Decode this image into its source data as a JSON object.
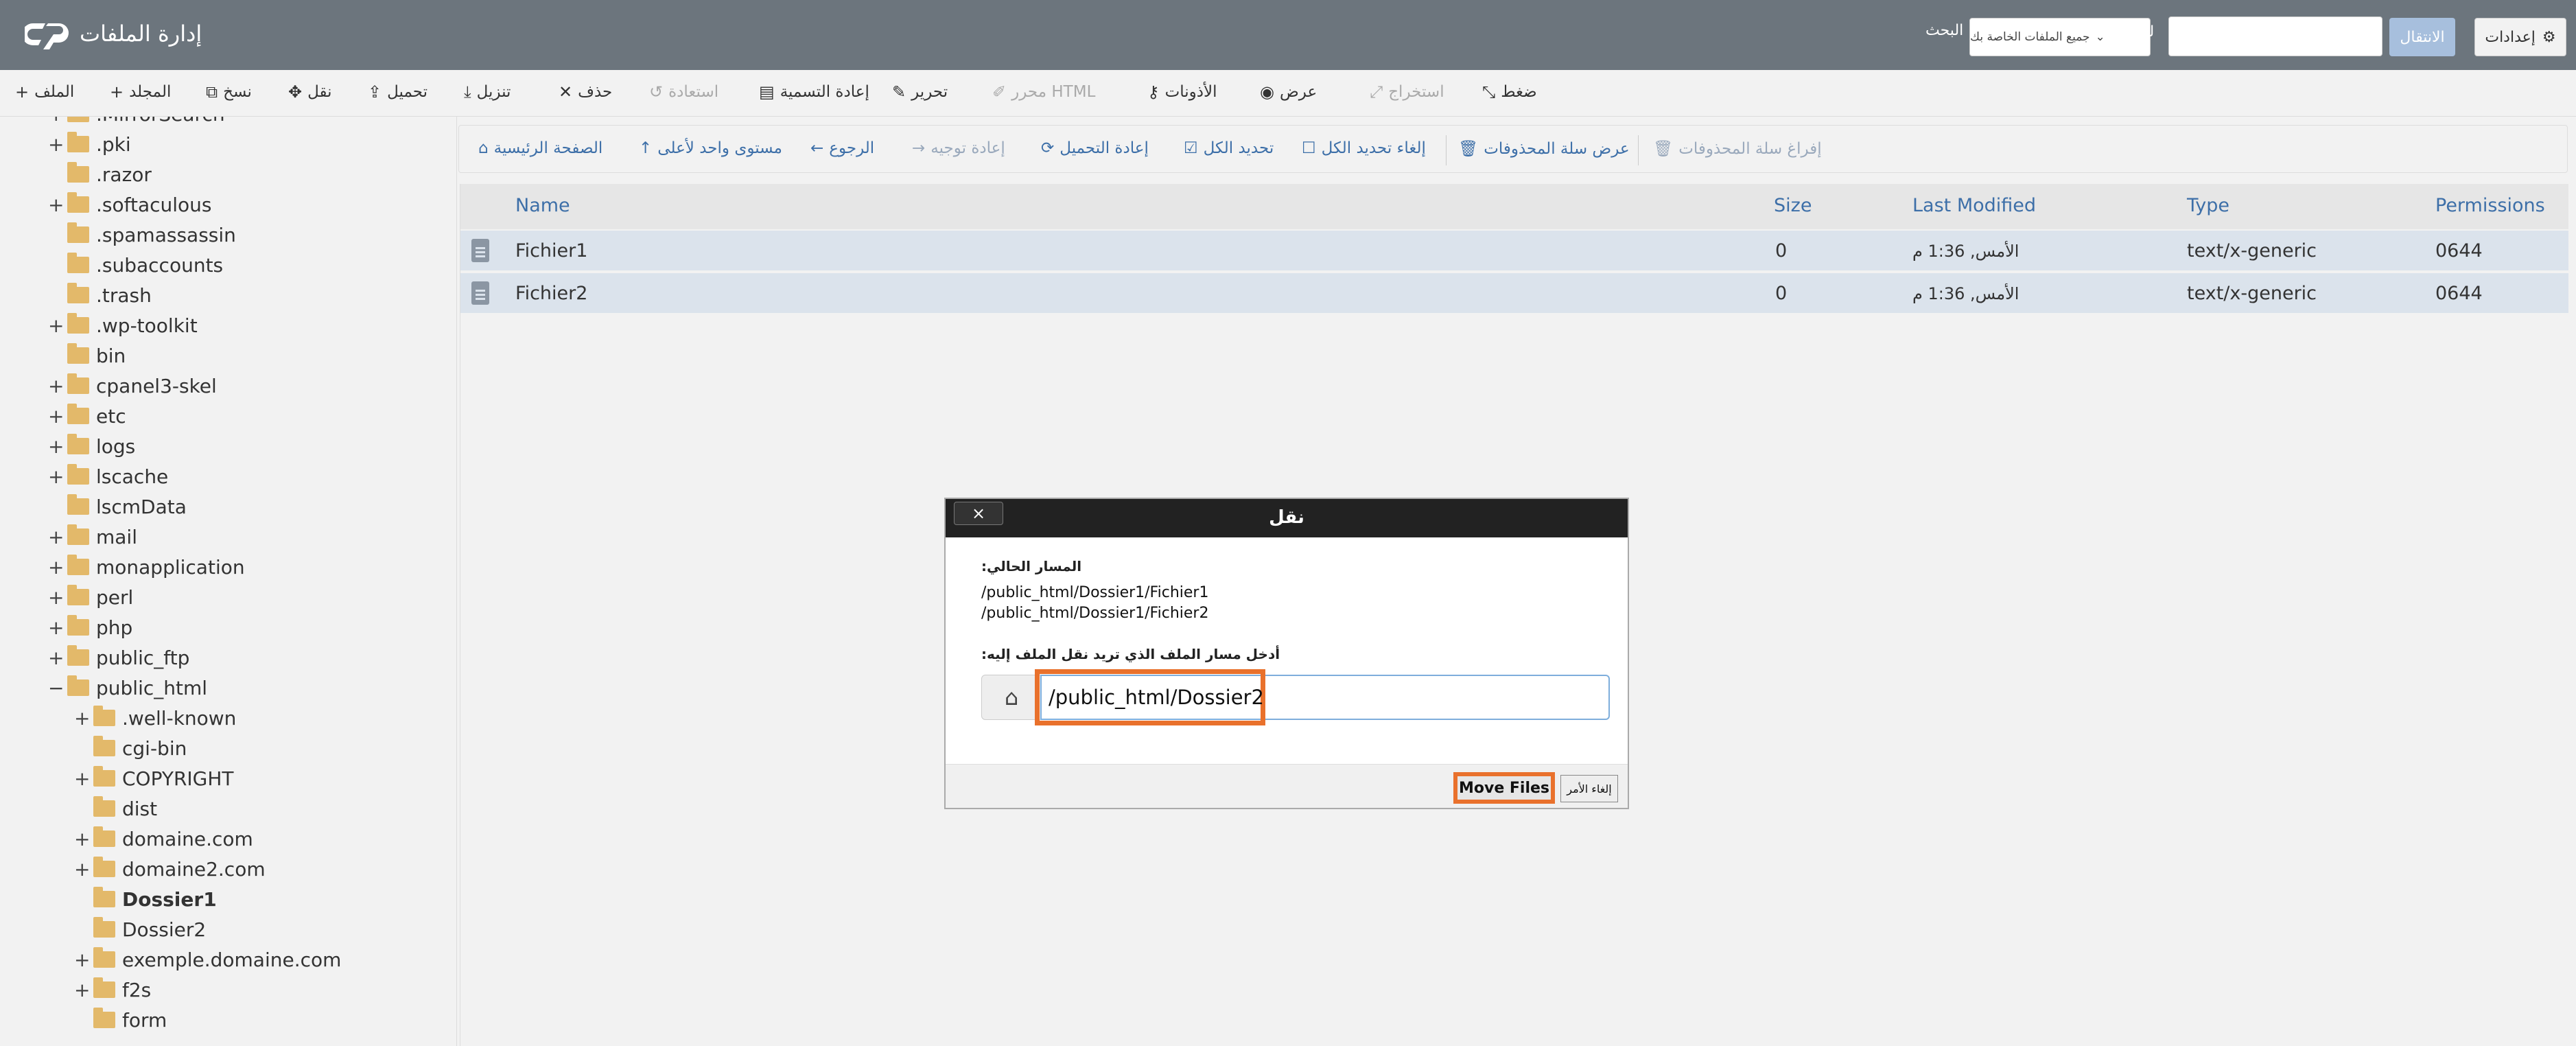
{
  "header": {
    "title": "إدارة الملفات",
    "settings_label": "إعدادات",
    "go_label": "الانتقال",
    "for_label": "لـ",
    "scope_value": "جميع الملفات الخاصة بك",
    "search_label": "البحث"
  },
  "toolbar": {
    "file": "الملف",
    "folder": "المجلد",
    "copy": "نسخ",
    "move": "نقل",
    "upload": "تحميل",
    "download": "تنزيل",
    "delete": "حذف",
    "restore": "استعادة",
    "rename": "إعادة التسمية",
    "edit": "تحرير",
    "html_editor": "محرر HTML",
    "permissions": "الأذونات",
    "view": "عرض",
    "extract": "استخراج",
    "compress": "ضغط"
  },
  "nav": {
    "home": "الصفحة الرئيسية",
    "up": "مستوى واحد لأعلى",
    "back": "الرجوع",
    "forward": "إعادة توجيه",
    "reload": "إعادة التحميل",
    "select_all": "تحديد الكل",
    "unselect_all": "إلغاء تحديد الكل",
    "view_trash": "عرض سلة المحذوفات",
    "empty_trash": "إفراغ سلة المحذوفات"
  },
  "tree": [
    {
      "label": ".MirrorSearch",
      "expander": "+",
      "indent": 0
    },
    {
      "label": ".pki",
      "expander": "+",
      "indent": 0
    },
    {
      "label": ".razor",
      "expander": "",
      "indent": 0
    },
    {
      "label": ".softaculous",
      "expander": "+",
      "indent": 0
    },
    {
      "label": ".spamassassin",
      "expander": "",
      "indent": 0
    },
    {
      "label": ".subaccounts",
      "expander": "",
      "indent": 0
    },
    {
      "label": ".trash",
      "expander": "",
      "indent": 0
    },
    {
      "label": ".wp-toolkit",
      "expander": "+",
      "indent": 0
    },
    {
      "label": "bin",
      "expander": "",
      "indent": 0
    },
    {
      "label": "cpanel3-skel",
      "expander": "+",
      "indent": 0
    },
    {
      "label": "etc",
      "expander": "+",
      "indent": 0
    },
    {
      "label": "logs",
      "expander": "+",
      "indent": 0
    },
    {
      "label": "lscache",
      "expander": "+",
      "indent": 0
    },
    {
      "label": "lscmData",
      "expander": "",
      "indent": 0
    },
    {
      "label": "mail",
      "expander": "+",
      "indent": 0
    },
    {
      "label": "monapplication",
      "expander": "+",
      "indent": 0
    },
    {
      "label": "perl",
      "expander": "+",
      "indent": 0
    },
    {
      "label": "php",
      "expander": "+",
      "indent": 0
    },
    {
      "label": "public_ftp",
      "expander": "+",
      "indent": 0
    },
    {
      "label": "public_html",
      "expander": "−",
      "indent": 0
    },
    {
      "label": ".well-known",
      "expander": "+",
      "indent": 1
    },
    {
      "label": "cgi-bin",
      "expander": "",
      "indent": 1
    },
    {
      "label": "COPYRIGHT",
      "expander": "+",
      "indent": 1
    },
    {
      "label": "dist",
      "expander": "",
      "indent": 1
    },
    {
      "label": "domaine.com",
      "expander": "+",
      "indent": 1
    },
    {
      "label": "domaine2.com",
      "expander": "+",
      "indent": 1
    },
    {
      "label": "Dossier1",
      "expander": "",
      "indent": 1,
      "bold": true
    },
    {
      "label": "Dossier2",
      "expander": "",
      "indent": 1
    },
    {
      "label": "exemple.domaine.com",
      "expander": "+",
      "indent": 1
    },
    {
      "label": "f2s",
      "expander": "+",
      "indent": 1
    },
    {
      "label": "form",
      "expander": "",
      "indent": 1
    }
  ],
  "table": {
    "headers": {
      "name": "Name",
      "size": "Size",
      "modified": "Last Modified",
      "type": "Type",
      "permissions": "Permissions"
    },
    "rows": [
      {
        "name": "Fichier1",
        "size": "0",
        "modified": "الأمس, 1:36 م",
        "type": "text/x-generic",
        "permissions": "0644"
      },
      {
        "name": "Fichier2",
        "size": "0",
        "modified": "الأمس, 1:36 م",
        "type": "text/x-generic",
        "permissions": "0644"
      }
    ]
  },
  "modal": {
    "title": "نقل",
    "close": "×",
    "current_path_label": "المسار الحالي:",
    "paths": [
      "/public_html/Dossier1/Fichier1",
      "/public_html/Dossier1/Fichier2"
    ],
    "dest_label": "أدخل مسار الملف الذي تريد نقل الملف إليه:",
    "dest_value": "/public_html/Dossier2",
    "move_label": "Move Files",
    "cancel_label": "إلغاء الأمر"
  },
  "colors": {
    "header_bg": "#6c757d",
    "link": "#3d6fa8",
    "highlight": "#e9712c",
    "folder": "#e3b96a",
    "selected_row": "#dbe3ec"
  },
  "icons": {
    "logo": "cpanel-logo-icon",
    "settings": "gear-icon",
    "home": "home-icon",
    "folder": "folder-icon",
    "file": "file-icon"
  }
}
